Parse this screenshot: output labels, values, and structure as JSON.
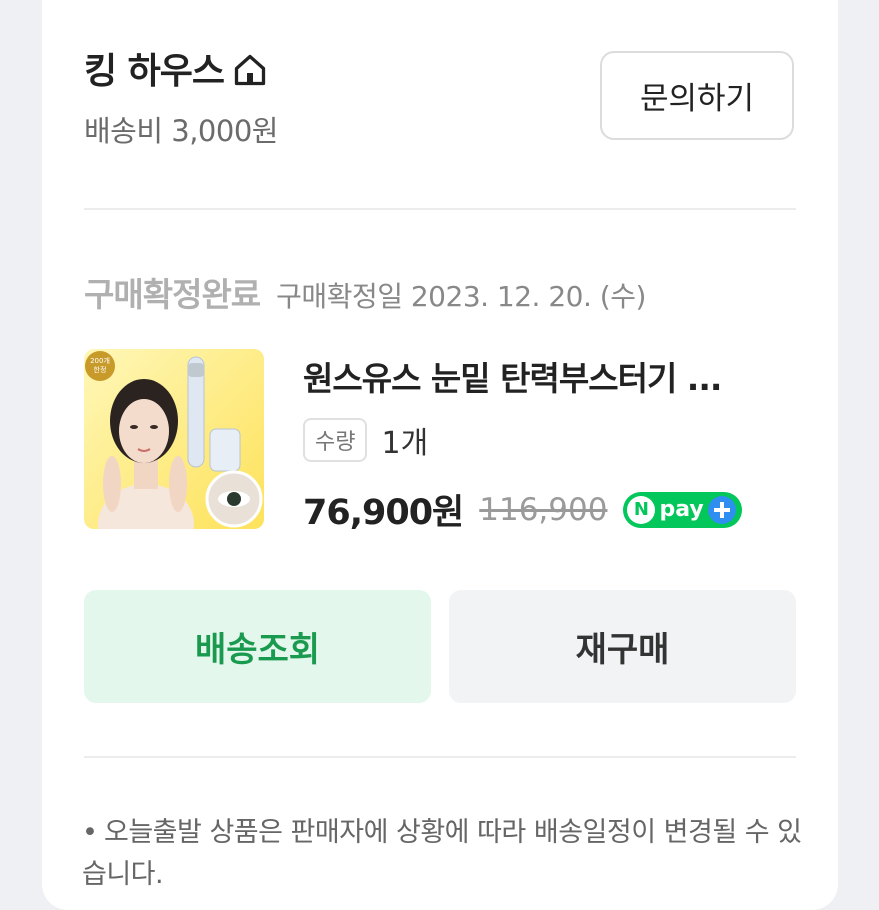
{
  "store": {
    "name": "킹 하우스",
    "shipping_fee": "배송비 3,000원",
    "inquiry_label": "문의하기"
  },
  "order": {
    "status": "구매확정완료",
    "confirm_date": "구매확정일 2023. 12. 20. (수)"
  },
  "product": {
    "title": "원스유스 눈밑 탄력부스터기 ...",
    "qty_label": "수량",
    "qty_value": "1개",
    "price": "76,900원",
    "original_price": "116,900",
    "pay_text": "pay",
    "badge": "200개 한정"
  },
  "actions": {
    "track_label": "배송조회",
    "rebuy_label": "재구매"
  },
  "notice": {
    "text": "오늘출발 상품은 판매자에 상황에 따라 배송일정이 변경될 수 있습니다."
  },
  "colors": {
    "accent_green": "#03c75a",
    "track_bg": "#e3f7ec",
    "track_text": "#1a9a4f"
  }
}
